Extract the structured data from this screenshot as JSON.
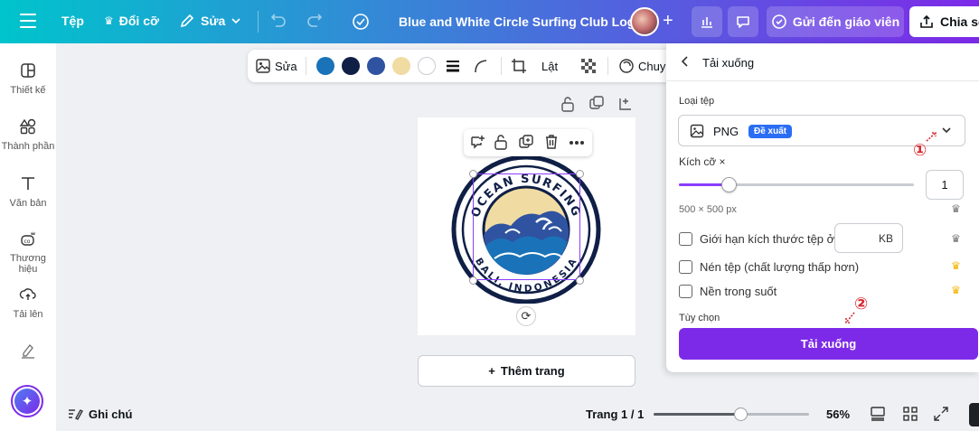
{
  "topbar": {
    "file": "Tệp",
    "resize": "Đổi cỡ",
    "edit": "Sửa",
    "title": "Blue and White Circle Surfing Club Logo",
    "send_to_teacher": "Gửi đến giáo viên",
    "share": "Chia sẻ"
  },
  "sidebar": {
    "items": [
      {
        "label": "Thiết kế",
        "icon": "layout-icon"
      },
      {
        "label": "Thành phần",
        "icon": "elements-icon"
      },
      {
        "label": "Văn bản",
        "icon": "text-icon"
      },
      {
        "label": "Thương hiệu",
        "icon": "brand-icon"
      },
      {
        "label": "Tải lên",
        "icon": "upload-icon"
      },
      {
        "label": "",
        "icon": "draw-icon"
      }
    ]
  },
  "context_toolbar": {
    "edit": "Sửa",
    "crop": "Lật",
    "convert": "Chuyển",
    "colors": [
      "#1a73b8",
      "#0f1f46",
      "#2f53a0",
      "#f0dca3",
      "#ffffff"
    ]
  },
  "canvas": {
    "logo_top_text": "OCEAN SURFING",
    "logo_bottom_text": "BALI, INDONESIA",
    "add_page": "Thêm trang"
  },
  "bottombar": {
    "notes": "Ghi chú",
    "page_indicator": "Trang 1 / 1",
    "zoom": "56%",
    "zoom_level_percent": 56
  },
  "download_panel": {
    "title": "Tải xuống",
    "file_type_label": "Loại tệp",
    "file_type_value": "PNG",
    "recommended_badge": "Đề xuất",
    "size_label": "Kích cỡ ×",
    "size_value": "1",
    "size_slider_fraction": 0.21,
    "dimensions": "500 × 500 px",
    "limit_file_size": "Giới hạn kích thước tệp ở",
    "kb_unit": "KB",
    "compress": "Nén tệp (chất lượng thấp hơn)",
    "transparent_bg": "Nền trong suốt",
    "options_label": "Tùy chọn",
    "download_button": "Tải xuống"
  },
  "annotations": {
    "marker_1": "①",
    "marker_2": "②"
  }
}
